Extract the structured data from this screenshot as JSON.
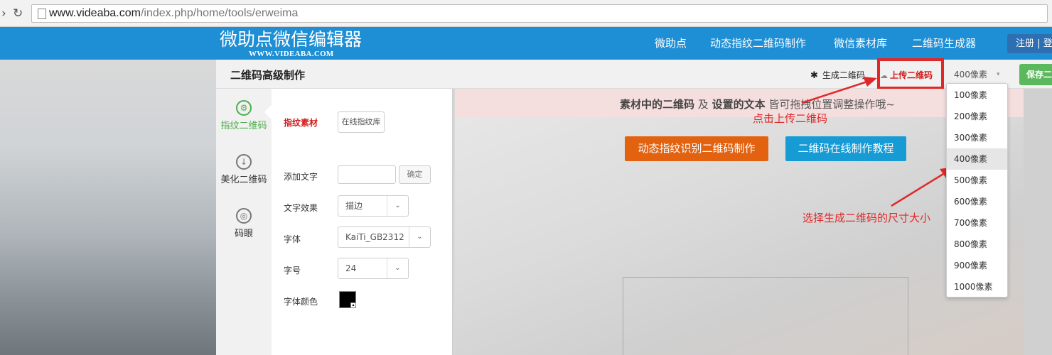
{
  "browser": {
    "back_icon": "back-arrow-icon",
    "reload_icon": "reload-icon",
    "url_host": "www.videaba.com",
    "url_path": "/index.php/home/tools/erweima"
  },
  "header": {
    "logo_title": "微助点微信编辑器",
    "logo_subtitle": "WWW.VIDEABA.COM",
    "nav": [
      "微助点",
      "动态指纹二维码制作",
      "微信素材库",
      "二维码生成器"
    ],
    "register_label": "注册 | 登",
    "accent_color": "#1f8fd5"
  },
  "editor": {
    "title": "二维码高级制作",
    "generate_label": "生成二维码",
    "upload_label": "上传二维码",
    "size_value": "400像素",
    "save_label": "保存二"
  },
  "side_tabs": [
    {
      "label": "指纹二维码",
      "icon": "gear-icon"
    },
    {
      "label": "美化二维码",
      "icon": "download-circle-icon"
    },
    {
      "label": "码眼",
      "icon": "ring-icon"
    }
  ],
  "form": {
    "heading": "指纹素材",
    "library_button": "在线指纹库",
    "add_text_label": "添加文字",
    "add_text_value": "",
    "confirm_label": "确定",
    "effect_label": "文字效果",
    "effect_value": "描边",
    "font_label": "字体",
    "font_value": "KaiTi_GB2312",
    "size_label": "字号",
    "size_value": "24",
    "color_label": "字体颜色",
    "color_value": "#000000"
  },
  "canvas": {
    "notice_bold1": "素材中的二维码",
    "notice_mid": " 及 ",
    "notice_bold2": "设置的文本",
    "notice_rest": " 皆可拖拽位置调整操作哦~",
    "orange_button": "动态指纹识别二维码制作",
    "blue_button": "二维码在线制作教程"
  },
  "annotations": {
    "upload_hint": "点击上传二维码",
    "size_hint": "选择生成二维码的尺寸大小",
    "color": "#e02828"
  },
  "size_options": [
    "100像素",
    "200像素",
    "300像素",
    "400像素",
    "500像素",
    "600像素",
    "700像素",
    "800像素",
    "900像素",
    "1000像素"
  ]
}
